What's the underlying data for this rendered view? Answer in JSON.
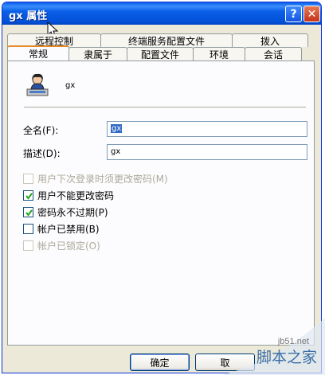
{
  "window": {
    "title": "gx 属性"
  },
  "title_buttons": {
    "help": "?",
    "close": "✕"
  },
  "tabs_back": [
    {
      "label": "远程控制",
      "width": 118
    },
    {
      "label": "终端服务配置文件",
      "width": 166
    },
    {
      "label": "拨入",
      "width": 96
    }
  ],
  "tabs_front": [
    {
      "label": "常规",
      "width": 78,
      "active": true
    },
    {
      "label": "隶属于",
      "width": 74
    },
    {
      "label": "配置文件",
      "width": 84
    },
    {
      "label": "环境",
      "width": 66
    },
    {
      "label": "会话",
      "width": 72
    }
  ],
  "general": {
    "username": "gx",
    "full_name_label": "全名(F):",
    "full_name_value": "gx",
    "description_label": "描述(D):",
    "description_value": "gx"
  },
  "checkboxes": [
    {
      "label": "用户下次登录时须更改密码(M)",
      "checked": false,
      "disabled": true
    },
    {
      "label": "用户不能更改密码",
      "checked": true,
      "disabled": false
    },
    {
      "label": "密码永不过期(P)",
      "checked": true,
      "disabled": false
    },
    {
      "label": "帐户已禁用(B)",
      "checked": false,
      "disabled": false
    },
    {
      "label": "帐户已锁定(O)",
      "checked": false,
      "disabled": true
    }
  ],
  "buttons": {
    "ok": "确定",
    "cancel": "取"
  },
  "watermark": {
    "url": "jb51.net",
    "text": "脚本之家"
  }
}
